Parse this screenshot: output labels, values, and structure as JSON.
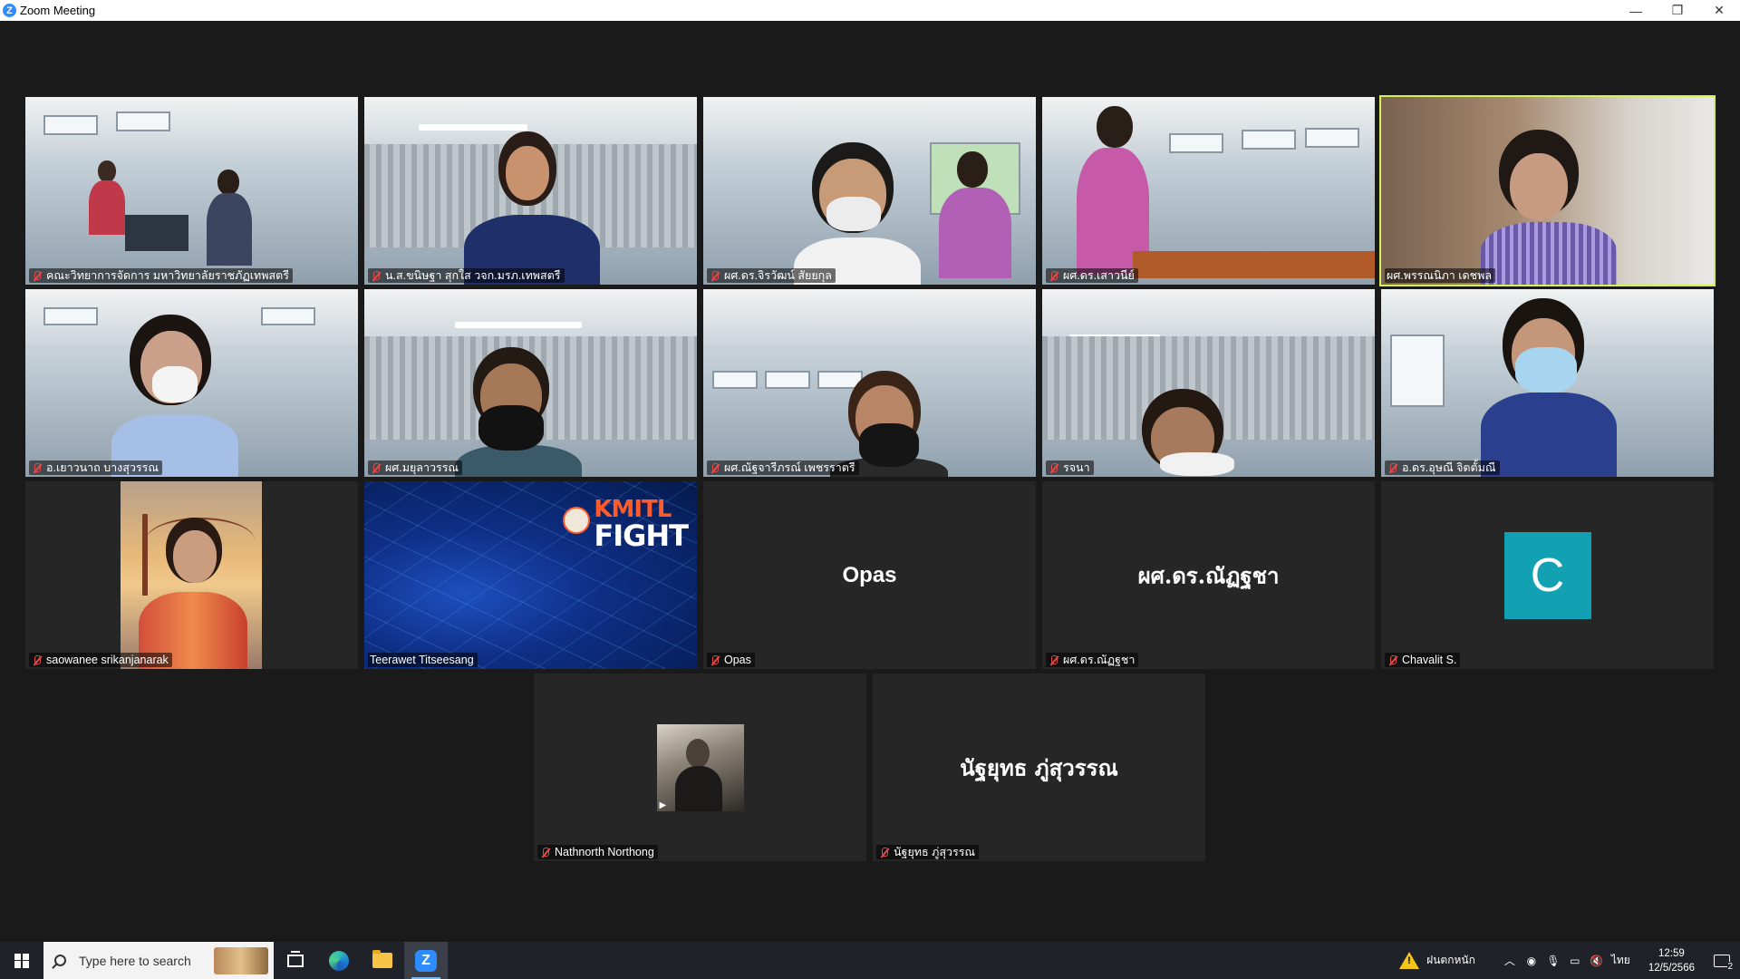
{
  "window": {
    "title": "Zoom Meeting",
    "controls": {
      "minimize": "—",
      "restore": "❐",
      "close": "✕"
    }
  },
  "participants": [
    {
      "name": "คณะวิทยาการจัดการ มหาวิทยาลัยราชภัฏเทพสตรี",
      "muted": true,
      "video": true
    },
    {
      "name": "น.ส.ขนิษฐา สุกใส วจก.มรภ.เทพสตรี",
      "muted": true,
      "video": true
    },
    {
      "name": "ผศ.ดร.จิรวัฒน์ สัยยกุล",
      "muted": true,
      "video": true
    },
    {
      "name": "ผศ.ดร.เสาวนีย์",
      "muted": true,
      "video": true
    },
    {
      "name": "ผศ.พรรณนิภา เดชพล",
      "muted": false,
      "video": true,
      "active_speaker": true
    },
    {
      "name": "อ.เยาวนาถ บางสุวรรณ",
      "muted": true,
      "video": true
    },
    {
      "name": "ผศ.มยุลาวรรณ",
      "muted": true,
      "video": true
    },
    {
      "name": "ผศ.ณัฐจารีภรณ์ เพชรราตรี",
      "muted": true,
      "video": true
    },
    {
      "name": "รจนา",
      "muted": true,
      "video": true
    },
    {
      "name": "อ.ดร.อุษณี จิตตั้มณี",
      "muted": true,
      "video": true
    },
    {
      "name": "saowanee srikanjanarak",
      "muted": true,
      "video": true
    },
    {
      "name": "Teerawet Titseesang",
      "muted": false,
      "video": true
    },
    {
      "name": "Opas",
      "muted": true,
      "video": false,
      "display": "Opas"
    },
    {
      "name": "ผศ.ดร.ณัฏฐชา",
      "muted": true,
      "video": false,
      "display": "ผศ.ดร.ณัฏฐชา"
    },
    {
      "name": "Chavalit S.",
      "muted": true,
      "video": false,
      "avatar_letter": "C",
      "avatar_color": "#12a1b2"
    },
    {
      "name": "Nathnorth Northong",
      "muted": true,
      "video": false
    },
    {
      "name": "นัฐยุทธ ภู่สุวรรณ",
      "muted": true,
      "video": false,
      "display": "นัฐยุทธ ภู่สุวรรณ"
    }
  ],
  "kmitl_banner": {
    "line1": "KMITL",
    "line2": "FIGHT"
  },
  "taskbar": {
    "search_placeholder": "Type here to search",
    "apps": [
      "task-view",
      "edge",
      "file-explorer",
      "zoom"
    ],
    "weather": "ฝนตกหนัก",
    "language": "ไทย",
    "time": "12:59",
    "date": "12/5/2566",
    "notifications": "2"
  },
  "colors": {
    "active_speaker_outline": "#d6f05c",
    "zoom_blue": "#2D8CFF",
    "background": "#1a1a1a",
    "tile": "#262626"
  }
}
